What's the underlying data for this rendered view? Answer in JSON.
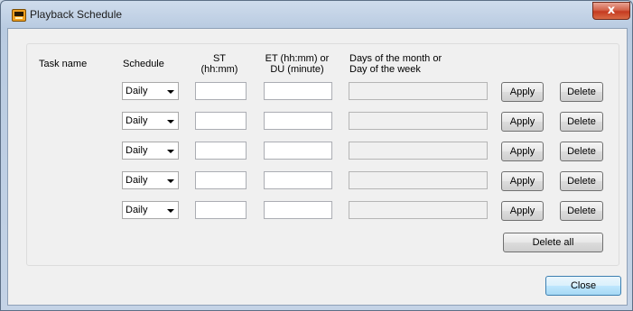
{
  "window": {
    "title": "Playback Schedule",
    "close_glyph": "x",
    "app_icon": "app-icon"
  },
  "headers": {
    "task_name": "Task name",
    "schedule": "Schedule",
    "st_1": "ST",
    "st_2": "(hh:mm)",
    "et_1": "ET (hh:mm) or",
    "et_2": "DU (minute)",
    "days_1": "Days of the month or",
    "days_2": "Day of the week"
  },
  "rows": [
    {
      "schedule": "Daily",
      "st": "",
      "et": "",
      "days": "",
      "apply": "Apply",
      "delete": "Delete"
    },
    {
      "schedule": "Daily",
      "st": "",
      "et": "",
      "days": "",
      "apply": "Apply",
      "delete": "Delete"
    },
    {
      "schedule": "Daily",
      "st": "",
      "et": "",
      "days": "",
      "apply": "Apply",
      "delete": "Delete"
    },
    {
      "schedule": "Daily",
      "st": "",
      "et": "",
      "days": "",
      "apply": "Apply",
      "delete": "Delete"
    },
    {
      "schedule": "Daily",
      "st": "",
      "et": "",
      "days": "",
      "apply": "Apply",
      "delete": "Delete"
    }
  ],
  "buttons": {
    "delete_all": "Delete all",
    "close": "Close"
  }
}
